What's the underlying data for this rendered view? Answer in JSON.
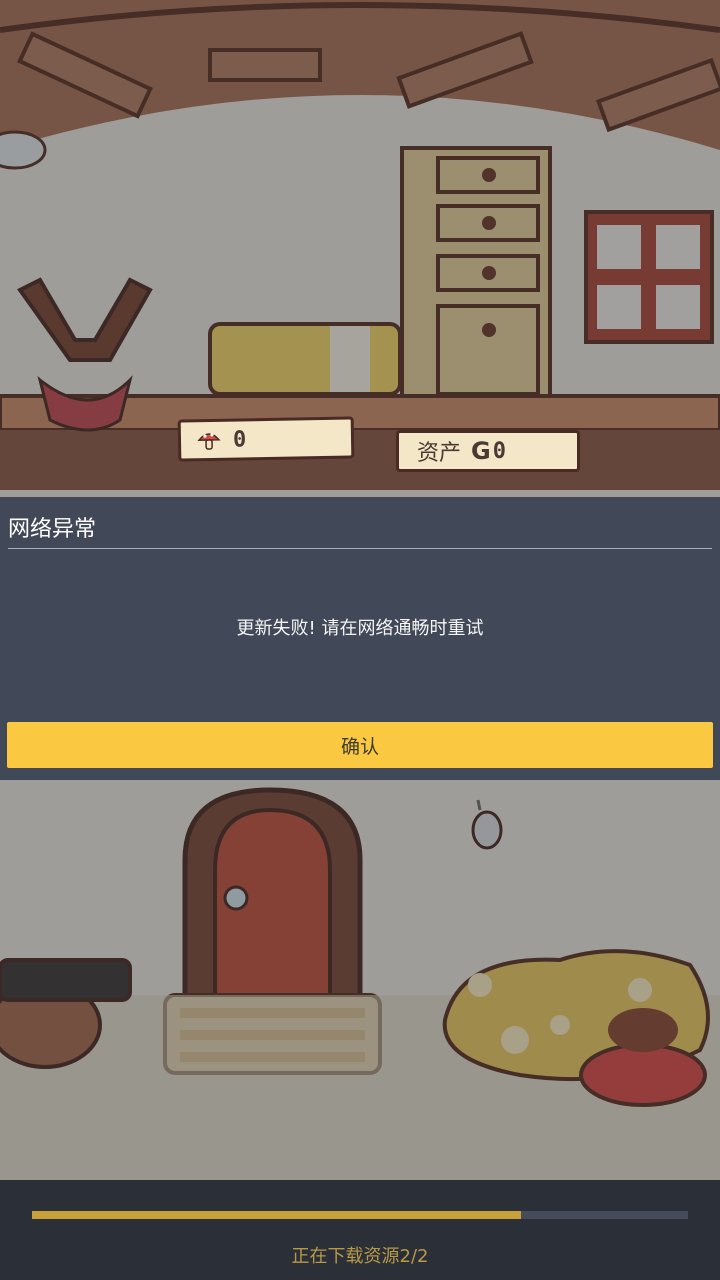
{
  "counters": {
    "mushroom_value": "0",
    "asset_label": "资产",
    "asset_value": "0"
  },
  "dialog": {
    "title": "网络异常",
    "message": "更新失败! 请在网络通畅时重试",
    "confirm_label": "确认"
  },
  "download": {
    "status_text": "正在下载资源2/2",
    "progress": 0.745
  },
  "colors": {
    "dialog_bg": "#3a4252",
    "confirm_button": "#fbc941",
    "progress_fill": "#c8a13b",
    "progress_text": "#b89a47"
  }
}
